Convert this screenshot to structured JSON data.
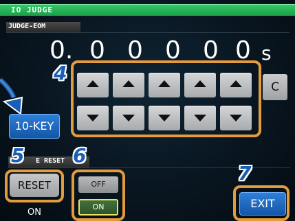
{
  "window": {
    "title": "IO JUDGE"
  },
  "section": {
    "label": "JUDGE-EOM"
  },
  "value": {
    "digits": [
      "0.",
      "0",
      "0",
      "0",
      "0",
      "0"
    ],
    "unit": "s"
  },
  "keypad": {
    "up_labels": [
      "up",
      "up",
      "up",
      "up",
      "up"
    ],
    "down_labels": [
      "down",
      "down",
      "down",
      "down",
      "down"
    ],
    "clear_label": "C",
    "tenkey_label": "10-KEY"
  },
  "reset_section": {
    "label_visible": "E RESET",
    "reset_label": "RESET",
    "off_label": "OFF",
    "on_label": "ON",
    "current_state": "ON"
  },
  "exit_label": "EXIT",
  "callouts": {
    "four": "4",
    "five": "5",
    "six": "6",
    "seven": "7"
  },
  "colors": {
    "title_bar": "#1fa64b",
    "callout_blue": "#1a5fb6",
    "highlight_orange": "#e39b3c",
    "button_blue": "#1356a8",
    "on_green": "#2c5527"
  }
}
